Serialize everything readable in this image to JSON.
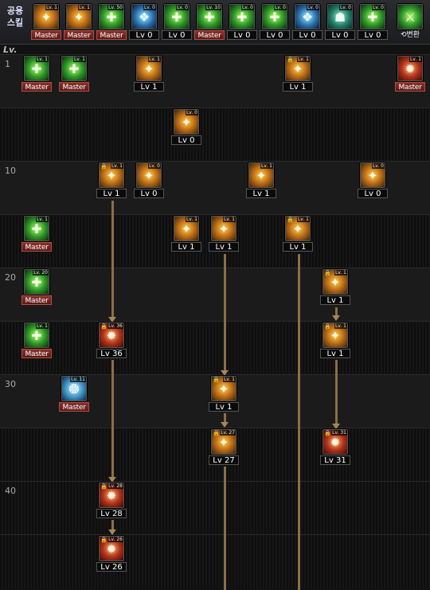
{
  "common": {
    "label": "공용\n스킬",
    "skills": [
      {
        "icon": "tiger-strike-icon",
        "color": "gold",
        "badge": "Lv. 1",
        "label": "Master"
      },
      {
        "icon": "roaring-tiger-icon",
        "color": "gold",
        "badge": "Lv. 1",
        "label": "Master"
      },
      {
        "icon": "green-slash-icon",
        "color": "green",
        "badge": "Lv. 50",
        "label": "Master"
      },
      {
        "icon": "blue-wings-icon",
        "color": "blue",
        "badge": "Lv. 0",
        "label": "Lv 0"
      },
      {
        "icon": "green-target-icon",
        "color": "green",
        "badge": "Lv. 0",
        "label": "Lv 0"
      },
      {
        "icon": "green-target-icon",
        "color": "green",
        "badge": "Lv. 10",
        "label": "Master"
      },
      {
        "icon": "green-runner-icon",
        "color": "green",
        "badge": "Lv. 0",
        "label": "Lv 0"
      },
      {
        "icon": "green-fighter-icon",
        "color": "green",
        "badge": "Lv. 0",
        "label": "Lv 0"
      },
      {
        "icon": "blue-eye-icon",
        "color": "blue",
        "badge": "Lv. 0",
        "label": "Lv 0"
      },
      {
        "icon": "armor-figure-icon",
        "color": "teal",
        "badge": "Lv. 0",
        "label": "Lv 0"
      },
      {
        "icon": "green-scroll-icon",
        "color": "green",
        "badge": "Lv. 0",
        "label": "Lv 0"
      }
    ],
    "switch": {
      "icon": "switch-skill-icon",
      "label": "⟲변환"
    }
  },
  "lv_header": "Lv.",
  "level_numbers": [
    "1",
    "10",
    "20",
    "30",
    "40"
  ],
  "tree": [
    {
      "icon": "green-kick-icon",
      "color": "green",
      "badge": "Lv. 1",
      "label": "Master",
      "lock": false
    },
    {
      "icon": "green-stance-icon",
      "color": "green",
      "badge": "Lv. 1",
      "label": "Master",
      "lock": false
    },
    {
      "icon": "golden-slash-icon",
      "color": "gold",
      "badge": "Lv. 1",
      "label": "Lv 1",
      "lock": false
    },
    {
      "icon": "golden-rush-icon",
      "color": "gold",
      "badge": "Lv. 1",
      "label": "Lv 1",
      "lock": true
    },
    {
      "icon": "flame-burst-icon",
      "color": "red",
      "badge": "Lv. 1",
      "label": "Master",
      "lock": false
    },
    {
      "icon": "golden-aura-icon",
      "color": "gold",
      "badge": "Lv. 0",
      "label": "Lv 0",
      "lock": false
    },
    {
      "icon": "golden-crescent-icon",
      "color": "gold",
      "badge": "Lv. 1",
      "label": "Lv 1",
      "lock": true
    },
    {
      "icon": "golden-arc-icon",
      "color": "gold",
      "badge": "Lv. 0",
      "label": "Lv 0",
      "lock": false
    },
    {
      "icon": "golden-twin-icon",
      "color": "gold",
      "badge": "Lv. 1",
      "label": "Lv 1",
      "lock": false
    },
    {
      "icon": "golden-flower-icon",
      "color": "gold",
      "badge": "Lv. 0",
      "label": "Lv 0",
      "lock": false
    },
    {
      "icon": "green-burst-icon",
      "color": "green",
      "badge": "Lv. 1",
      "label": "Master",
      "lock": false
    },
    {
      "icon": "golden-wave-icon",
      "color": "gold",
      "badge": "Lv. 1",
      "label": "Lv 1",
      "lock": false
    },
    {
      "icon": "golden-spin-icon",
      "color": "gold",
      "badge": "Lv. 1",
      "label": "Lv 1",
      "lock": false
    },
    {
      "icon": "golden-star-icon",
      "color": "gold",
      "badge": "Lv. 1",
      "label": "Lv 1",
      "lock": true
    },
    {
      "icon": "green-blade-icon",
      "color": "green",
      "badge": "Lv. 20",
      "label": "Master",
      "lock": false
    },
    {
      "icon": "golden-explosion-icon",
      "color": "gold",
      "badge": "Lv. 1",
      "label": "Lv 1",
      "lock": true
    },
    {
      "icon": "green-dash-icon",
      "color": "green",
      "badge": "Lv. 1",
      "label": "Master",
      "lock": false
    },
    {
      "icon": "crimson-strike-icon",
      "color": "red",
      "badge": "Lv. 36",
      "label": "Lv 36",
      "lock": true
    },
    {
      "icon": "golden-pillar-icon",
      "color": "gold",
      "badge": "Lv. 1",
      "label": "Lv 1",
      "lock": true
    },
    {
      "icon": "blue-spirit-icon",
      "color": "skyblue",
      "badge": "Lv. 11",
      "label": "Master",
      "lock": false
    },
    {
      "icon": "golden-rays-icon",
      "color": "gold",
      "badge": "Lv. 1",
      "label": "Lv 1",
      "lock": true
    },
    {
      "icon": "golden-storm-icon",
      "color": "gold",
      "badge": "Lv. 27",
      "label": "Lv 27",
      "lock": true
    },
    {
      "icon": "crimson-nova-icon",
      "color": "red",
      "badge": "Lv. 31",
      "label": "Lv 31",
      "lock": true
    },
    {
      "icon": "crimson-fist-icon",
      "color": "red",
      "badge": "Lv. 28",
      "label": "Lv 28",
      "lock": true
    },
    {
      "icon": "crimson-flame-icon",
      "color": "red",
      "badge": "Lv. 26",
      "label": "Lv 26",
      "lock": true
    }
  ]
}
